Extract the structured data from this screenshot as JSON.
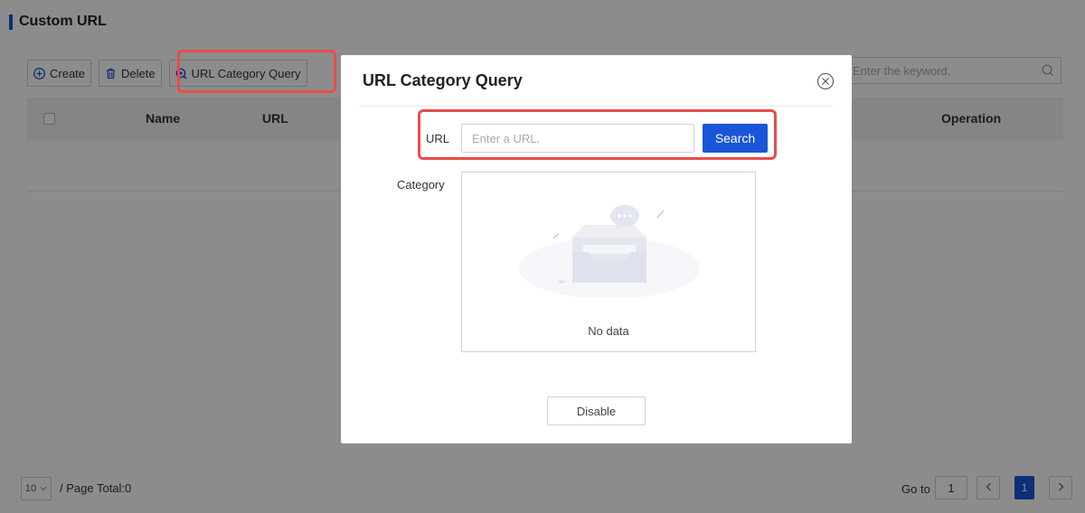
{
  "page": {
    "title": "Custom URL"
  },
  "toolbar": {
    "create_label": "Create",
    "delete_label": "Delete",
    "query_label": "URL Category Query"
  },
  "search": {
    "placeholder": "Enter the keyword."
  },
  "table": {
    "columns": [
      "Name",
      "URL",
      "Operation"
    ]
  },
  "pagination": {
    "page_size": "10",
    "page_total": "/ Page Total:0",
    "goto_label": "Go to",
    "goto_value": "1",
    "current_page": "1"
  },
  "modal": {
    "title": "URL Category Query",
    "url_label": "URL",
    "url_placeholder": "Enter a URL.",
    "search_label": "Search",
    "category_label": "Category",
    "no_data": "No data",
    "disable_label": "Disable"
  },
  "colors": {
    "accent": "#1a55d8",
    "highlight": "#e84c4c"
  }
}
